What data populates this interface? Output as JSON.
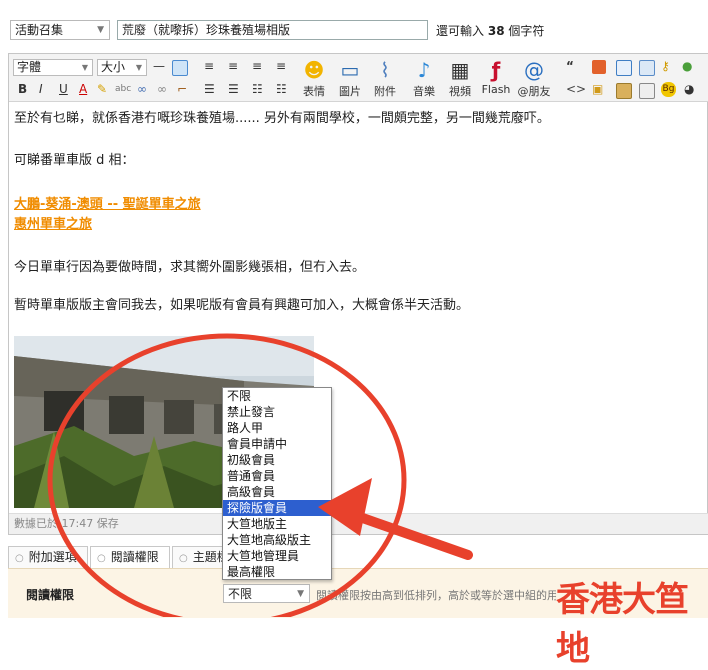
{
  "post": {
    "category_select": "活動召集",
    "subject": "荒廢（就嚟拆）珍珠養殖場相版",
    "char_hint_prefix": "還可輸入",
    "char_hint_count": "38",
    "char_hint_suffix": "個字符"
  },
  "toolbar": {
    "font_select": "字體",
    "size_select": "大小",
    "emoji_label": "表情",
    "image_label": "圖片",
    "attach_label": "附件",
    "music_label": "音樂",
    "video_label": "視頻",
    "flash_label": "Flash",
    "mention_label": "@朋友"
  },
  "content": {
    "para1": "至於有乜睇，就係香港冇嘅珍珠養殖場...... 另外有兩間學校，一間頗完整，另一間幾荒廢吓。",
    "para2": "可睇番單車版 d 相：",
    "link1": "大鵬-葵涌-澳頭 -- 聖誕單車之旅",
    "link2": "惠州單車之旅",
    "para3": "今日單車行因為要做時間，求其嚮外圍影幾張相，但冇入去。",
    "para4": "暫時單車版版主會同我去，如果呢版有會員有興趣可加入，大概會係半天活動。"
  },
  "status": {
    "save_text": "數據已於 17:47 保存"
  },
  "tabs": {
    "tab1": "附加選項",
    "tab2": "閱讀權限",
    "tab3": "主題標籤"
  },
  "permission": {
    "label": "閱讀權限",
    "selected": "不限",
    "help": "閱讀權限按由高到低排列，高於或等於選中組的用戶才可以閱讀"
  },
  "dropdown": {
    "options": [
      "不限",
      "禁止發言",
      "路人甲",
      "會員申請中",
      "初級會員",
      "普通會員",
      "高級會員",
      "探險版會員",
      "大笪地版主",
      "大笪地高級版主",
      "大笪地管理員",
      "最高權限"
    ],
    "highlighted": "探險版會員"
  },
  "watermark": "香港大笪地",
  "colors": {
    "annotation_red": "#e8412c",
    "link_orange": "#f08c00",
    "highlight_blue": "#2d5fcf"
  }
}
